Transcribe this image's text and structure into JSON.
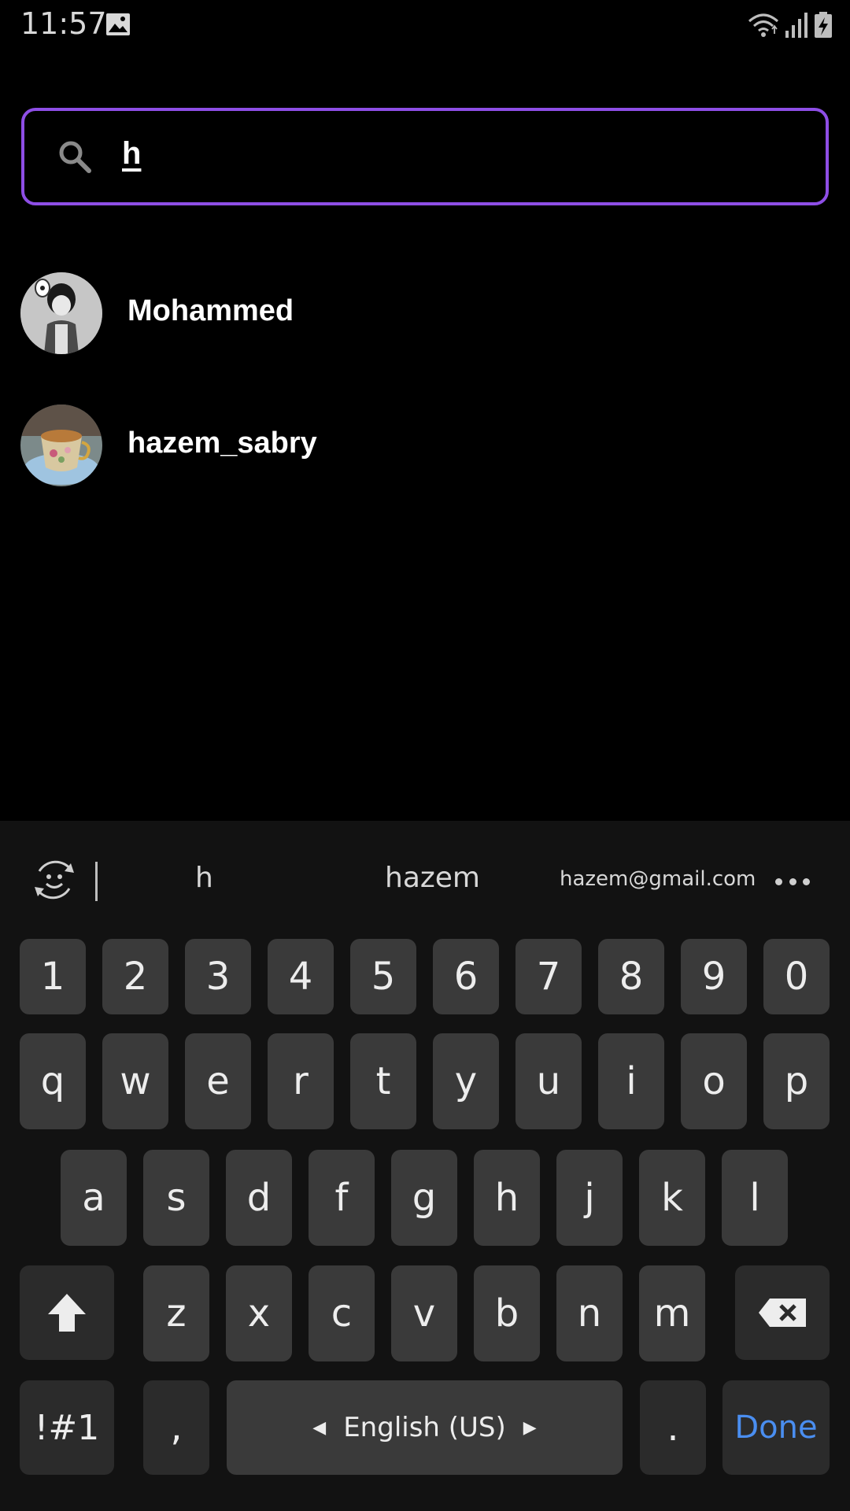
{
  "status_bar": {
    "time": "11:57",
    "icons": [
      "gallery-icon",
      "wifi-icon",
      "signal-icon",
      "battery-charging-icon"
    ]
  },
  "search": {
    "value": "h",
    "icon": "search-icon",
    "border_color": "#8e4ee6"
  },
  "results": [
    {
      "name": "Mohammed",
      "avatar": "anime-character-avatar"
    },
    {
      "name": "hazem_sabry",
      "avatar": "teacup-avatar"
    }
  ],
  "keyboard": {
    "suggestions": [
      "h",
      "hazem",
      "hazem@gmail.com"
    ],
    "number_row": [
      "1",
      "2",
      "3",
      "4",
      "5",
      "6",
      "7",
      "8",
      "9",
      "0"
    ],
    "row1": [
      "q",
      "w",
      "e",
      "r",
      "t",
      "y",
      "u",
      "i",
      "o",
      "p"
    ],
    "row2": [
      "a",
      "s",
      "d",
      "f",
      "g",
      "h",
      "j",
      "k",
      "l"
    ],
    "row3": [
      "z",
      "x",
      "c",
      "v",
      "b",
      "n",
      "m"
    ],
    "symbols_label": "!#1",
    "comma": ",",
    "space_label": "English (US)",
    "period": ".",
    "done_label": "Done",
    "accent_color": "#4a8ef0"
  }
}
